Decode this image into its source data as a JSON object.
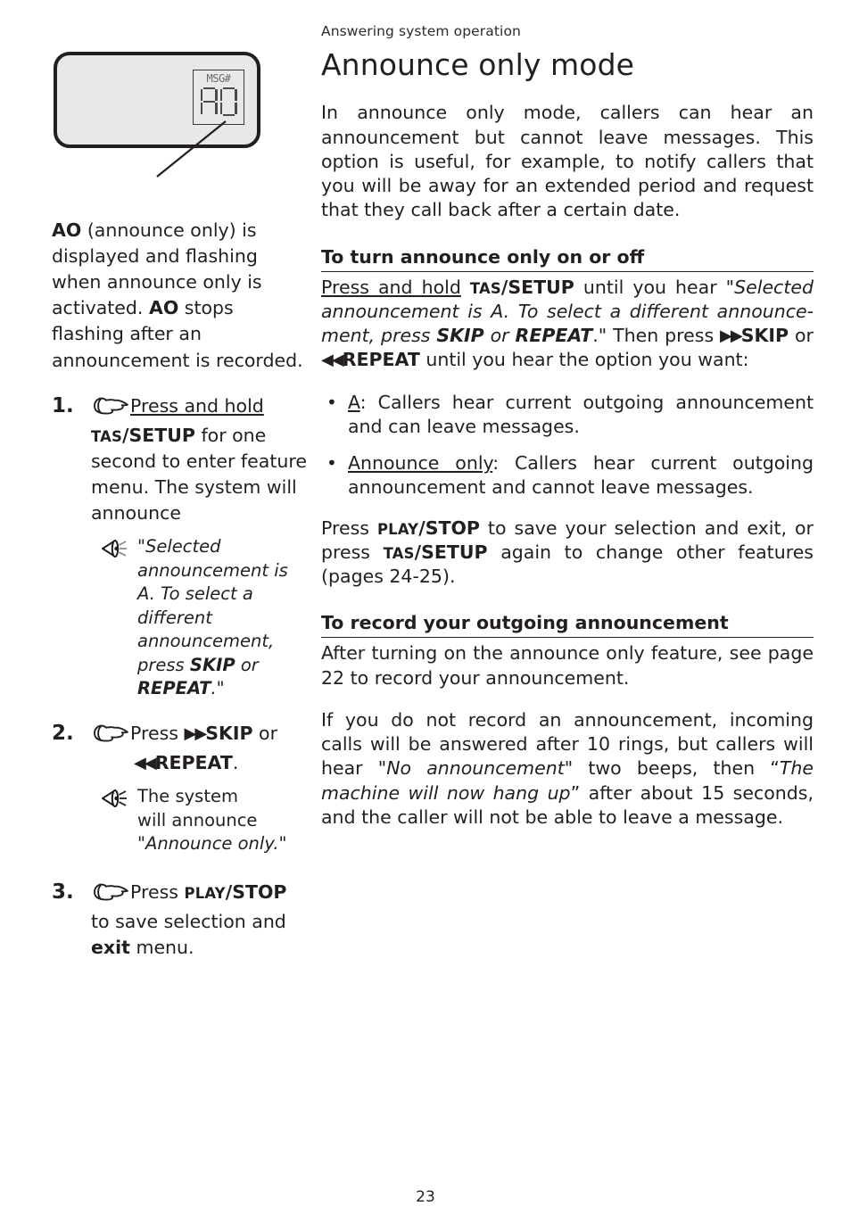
{
  "header": {
    "running_head": "Answering system operation"
  },
  "footer": {
    "page_number": "23"
  },
  "left_column": {
    "lcd": {
      "msg_label": "MSG#",
      "display_value": "AO",
      "icon_leader_line": "leader-line"
    },
    "caption": {
      "bold_lead": "AO",
      "text_1": " (announce only) is displayed and flashing when announce only is activated. ",
      "bold_mid": "AO",
      "text_2": " stops flashing after an announcement is recorded."
    },
    "steps": [
      {
        "number": "1.",
        "hand_icon": "pointing-hand-icon",
        "underlined": "Press and hold",
        "smallcaps": "TAS",
        "bold": "/SETUP",
        "rest": " for one second to enter feature menu. The system will announce",
        "note": {
          "speaker_icon": "speaker-icon",
          "quote_open": "\"",
          "italic_1": "Selected announcement is A. To select a different announcement, press ",
          "italic_bold_1": "SKIP",
          "italic_2": " or ",
          "italic_bold_2": "REPEAT",
          "quote_close": ".\""
        }
      },
      {
        "number": "2.",
        "hand_icon": "pointing-hand-icon",
        "press_label": "Press ",
        "skip_arrow": "▶▶",
        "skip_label": "SKIP",
        "or_label": " or ",
        "repeat_arrow": "◀◀",
        "repeat_label": "REPEAT",
        "period": ".",
        "note": {
          "speaker_icon": "speaker-icon",
          "line_1": "The system",
          "line_2": "will announce",
          "quote_open": "\"",
          "italic": "Announce only.",
          "quote_close": "\""
        }
      },
      {
        "number": "3.",
        "hand_icon": "pointing-hand-icon",
        "press_label": "Press ",
        "smallcaps": "PLAY",
        "bold": "/STOP",
        "rest_1": " to save selection and ",
        "bold_exit": "exit",
        "rest_2": " menu."
      }
    ]
  },
  "right_column": {
    "title": "Announce only mode",
    "intro": "In announce only mode, callers can hear an announcement but cannot leave messages. This option is useful, for example, to notify callers that you will be away for an extended period and request that they call back after a certain date.",
    "section_1": {
      "heading": "To turn announce only on or off",
      "para": {
        "underlined": "Press and hold",
        "smallcaps": "TAS",
        "bold": "/SETUP",
        "text_1": " until you hear \"",
        "italic_1": "Selected announcement is A. To select a different announce-ment, press ",
        "italic_bold_1": "SKIP",
        "italic_2": " or ",
        "italic_bold_2": "REPEAT",
        "text_2": ".\" Then press ",
        "skip_arrow": "▶▶",
        "skip_label": "SKIP",
        "or_label": " or ",
        "repeat_arrow": "◀◀",
        "repeat_label": "REPEAT",
        "text_3": " until you hear the option you want:"
      },
      "options": [
        {
          "term": "A",
          "desc": ": Callers hear current outgoing announcement and can leave messages."
        },
        {
          "term": "Announce only",
          "desc": ": Callers hear current outgoing announcement and cannot leave messages."
        }
      ],
      "save_para": {
        "press_1": "Press ",
        "smallcaps_1": "PLAY",
        "bold_1": "/STOP",
        "text_1": " to save your selection and exit, or press ",
        "smallcaps_2": "TAS",
        "bold_2": "/SETUP",
        "text_2": " again to change other features (pages 24-25)."
      }
    },
    "section_2": {
      "heading": "To record your outgoing announcement",
      "para_1": "After turning on the announce only feature, see page 22 to record your announcement.",
      "para_2": {
        "text_1": "If you do not record an announcement, incoming calls will be answered after 10 rings, but callers will hear \"",
        "italic_1": "No announcement",
        "text_2": "\" two beeps, then “",
        "italic_2": "The machine will now hang up",
        "text_3": "” after about 15 seconds, and the caller will not be able to leave a message."
      }
    }
  }
}
